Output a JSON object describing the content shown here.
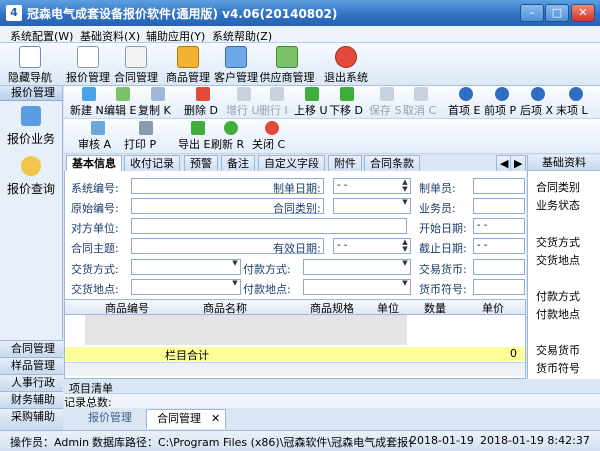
{
  "window": {
    "title": "冠森电气成套设备报价软件(通用版) v4.06(20140802)",
    "app_icon": "4",
    "minimize": "–",
    "maximize": "□",
    "close": "✕"
  },
  "menu": [
    "系统配置(W)",
    "基础资料(X)",
    "辅助应用(Y)",
    "系统帮助(Z)"
  ],
  "main_toolbar": {
    "hide_nav": "隐藏导航",
    "buttons": [
      "报价管理",
      "合同管理",
      "商品管理",
      "客户管理",
      "供应商管理",
      "退出系统"
    ]
  },
  "left_nav": {
    "header": "报价管理",
    "items": [
      "报价业务",
      "报价查询"
    ],
    "bottom": [
      "合同管理",
      "样品管理",
      "人事行政",
      "财务辅助",
      "采购辅助"
    ]
  },
  "toolbar1": {
    "new": "新建 N",
    "edit": "编辑 E",
    "copy": "复制 K",
    "delete": "删除 D",
    "add_row": "增行 U",
    "del_row": "删行 I",
    "move_up": "上移 U",
    "move_down": "下移 D",
    "save": "保存 S",
    "cancel": "取消 C",
    "first": "首项 E",
    "prev": "前项 P",
    "next": "后项 X",
    "last": "末项 L"
  },
  "toolbar2": {
    "audit": "审核 A",
    "print": "打印 P",
    "export": "导出 E",
    "refresh": "刷新 R",
    "close": "关闭 C"
  },
  "tabs": [
    "基本信息",
    "收付记录",
    "预警",
    "备注",
    "自定义字段",
    "附件",
    "合同条款"
  ],
  "tab_scroll": [
    "◀",
    "▶"
  ],
  "form": {
    "labels": {
      "system_no": "系统编号:",
      "origin_no": "原始编号:",
      "counterpart": "对方单位:",
      "subject": "合同主题:",
      "delivery_method": "交货方式:",
      "delivery_place": "交货地点:",
      "create_date": "制单日期:",
      "contract_type": "合同类别:",
      "valid_date": "有效日期:",
      "pay_method": "付款方式:",
      "pay_place": "付款地点:",
      "maker": "制单员:",
      "salesman": "业务员:",
      "start_date": "开始日期:",
      "end_date": "截止日期:",
      "currency": "交易货币:",
      "currency_symbol": "货币符号:"
    },
    "date_placeholder": "- -"
  },
  "grid": {
    "columns": [
      "商品编号",
      "商品名称",
      "商品规格",
      "单位",
      "数量",
      "单价"
    ],
    "total_label": "栏目合计",
    "total_value": "0"
  },
  "right_panel": {
    "header": "基础资料",
    "items": [
      "合同类别",
      "业务状态",
      "交货方式",
      "交货地点",
      "付款方式",
      "付款地点",
      "交易货币",
      "货币符号"
    ]
  },
  "footer": {
    "item_list": "项目清单",
    "record_total": "记录总数:",
    "doc_tabs": [
      "报价管理",
      "合同管理"
    ]
  },
  "status": {
    "operator": "操作员：Admin",
    "db_path": "数据库路径：C:\\Program Files (x86)\\冠森软件\\冠森电气成套报价",
    "date": "2018-01-19",
    "time": "2018-01-19 8:42:37"
  },
  "colors": {
    "accent": "#2f6fc2",
    "total_row": "#ffff99",
    "tab_active": "#ffffff"
  }
}
